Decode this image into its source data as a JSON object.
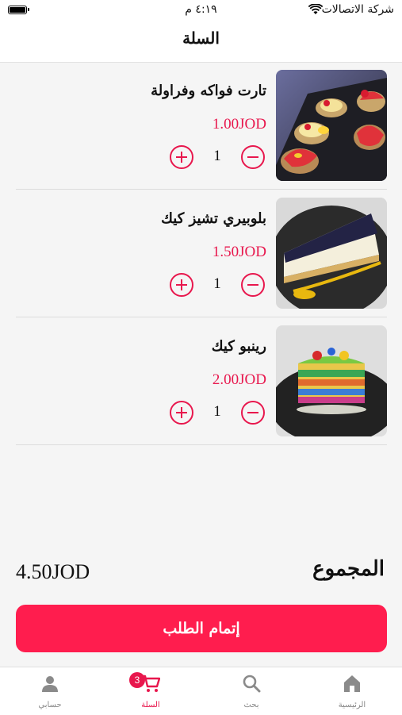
{
  "status_bar": {
    "carrier": "شركة الاتصالات",
    "time": "٤:١٩ م"
  },
  "header": {
    "title": "السلة"
  },
  "cart": {
    "items": [
      {
        "name": "تارت فواكه وفراولة",
        "price": "1.00JOD",
        "quantity": "1",
        "image": "fruit-tart-photo"
      },
      {
        "name": "بلوبيري تشيز كيك",
        "price": "1.50JOD",
        "quantity": "1",
        "image": "blueberry-cheesecake-photo"
      },
      {
        "name": "رينبو كيك",
        "price": "2.00JOD",
        "quantity": "1",
        "image": "rainbow-cake-photo"
      }
    ]
  },
  "total": {
    "label": "المجموع",
    "value": "4.50JOD"
  },
  "checkout": {
    "label": "إتمام الطلب"
  },
  "tab_bar": {
    "tabs": [
      {
        "label": "الرئيسية",
        "icon": "home-icon",
        "active": false
      },
      {
        "label": "بحث",
        "icon": "search-icon",
        "active": false
      },
      {
        "label": "السلة",
        "icon": "cart-icon",
        "active": true,
        "badge": "3"
      },
      {
        "label": "حسابي",
        "icon": "person-icon",
        "active": false
      }
    ]
  },
  "colors": {
    "accent": "#e8174d",
    "button": "#ff1d4e",
    "background": "#f5f5f5"
  }
}
